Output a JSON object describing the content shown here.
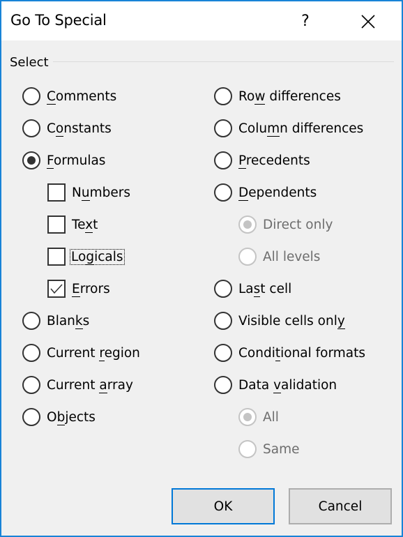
{
  "window": {
    "title": "Go To Special",
    "help_label": "?",
    "close_icon": "close-icon",
    "border_color": "#1883d7"
  },
  "group": {
    "label": "Select"
  },
  "left_options": [
    {
      "pre": "",
      "u": "C",
      "post": "omments",
      "type": "radio",
      "checked": false
    },
    {
      "pre": "C",
      "u": "o",
      "post": "nstants",
      "type": "radio",
      "checked": false
    },
    {
      "pre": "",
      "u": "F",
      "post": "ormulas",
      "type": "radio",
      "checked": true
    },
    {
      "pre": "N",
      "u": "u",
      "post": "mbers",
      "type": "checkbox",
      "checked": false
    },
    {
      "pre": "Te",
      "u": "x",
      "post": "t",
      "type": "checkbox",
      "checked": false
    },
    {
      "pre": "Lo",
      "u": "g",
      "post": "icals",
      "type": "checkbox",
      "checked": false,
      "focused": true
    },
    {
      "pre": "",
      "u": "E",
      "post": "rrors",
      "type": "checkbox",
      "checked": true
    },
    {
      "pre": "Blan",
      "u": "k",
      "post": "s",
      "type": "radio",
      "checked": false
    },
    {
      "pre": "Current ",
      "u": "r",
      "post": "egion",
      "type": "radio",
      "checked": false
    },
    {
      "pre": "Current ",
      "u": "a",
      "post": "rray",
      "type": "radio",
      "checked": false
    },
    {
      "pre": "O",
      "u": "b",
      "post": "jects",
      "type": "radio",
      "checked": false
    }
  ],
  "right_options": [
    {
      "pre": "Ro",
      "u": "w",
      "post": " differences",
      "type": "radio",
      "checked": false
    },
    {
      "pre": "Colu",
      "u": "m",
      "post": "n differences",
      "type": "radio",
      "checked": false
    },
    {
      "pre": "",
      "u": "P",
      "post": "recedents",
      "type": "radio",
      "checked": false
    },
    {
      "pre": "",
      "u": "D",
      "post": "ependents",
      "type": "radio",
      "checked": false
    },
    {
      "pre": "Direct only",
      "u": "",
      "post": "",
      "type": "radio",
      "checked": true,
      "disabled": true
    },
    {
      "pre": "All levels",
      "u": "",
      "post": "",
      "type": "radio",
      "checked": false,
      "disabled": true
    },
    {
      "pre": "La",
      "u": "s",
      "post": "t cell",
      "type": "radio",
      "checked": false
    },
    {
      "pre": "Visible cells onl",
      "u": "y",
      "post": "",
      "type": "radio",
      "checked": false
    },
    {
      "pre": "Condi",
      "u": "t",
      "post": "ional formats",
      "type": "radio",
      "checked": false
    },
    {
      "pre": "Data ",
      "u": "v",
      "post": "alidation",
      "type": "radio",
      "checked": false
    },
    {
      "pre": "All",
      "u": "",
      "post": "",
      "type": "radio",
      "checked": true,
      "disabled": true
    },
    {
      "pre": "Same",
      "u": "",
      "post": "",
      "type": "radio",
      "checked": false,
      "disabled": true
    }
  ],
  "buttons": {
    "ok_label": "OK",
    "cancel_label": "Cancel"
  }
}
